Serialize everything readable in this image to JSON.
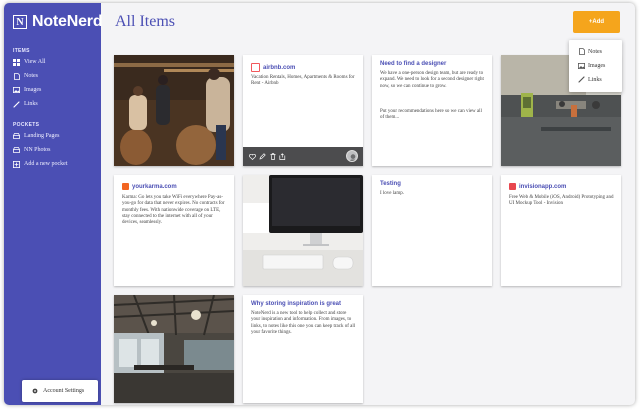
{
  "app": {
    "name": "NoteNerd",
    "logo_letter": "N"
  },
  "sidebar": {
    "items_title": "ITEMS",
    "items": [
      {
        "label": "View All",
        "icon": "grid-icon"
      },
      {
        "label": "Notes",
        "icon": "note-icon"
      },
      {
        "label": "Images",
        "icon": "image-icon"
      },
      {
        "label": "Links",
        "icon": "link-icon"
      }
    ],
    "pockets_title": "POCKETS",
    "pockets": [
      {
        "label": "Landing Pages",
        "icon": "tray-icon"
      },
      {
        "label": "NN Photos",
        "icon": "tray-icon"
      },
      {
        "label": "Add a new pocket",
        "icon": "plus-square-icon"
      }
    ],
    "account": {
      "label": "Account Settings",
      "icon": "gear-icon"
    }
  },
  "header": {
    "title": "All Items",
    "add_label": "+Add"
  },
  "add_menu": {
    "items": [
      {
        "label": "Notes",
        "icon": "note-icon"
      },
      {
        "label": "Images",
        "icon": "image-icon"
      },
      {
        "label": "Links",
        "icon": "link-icon"
      }
    ]
  },
  "cards": {
    "airbnb": {
      "link": "airbnb.com",
      "desc": "Vacation Rentals, Homes, Apartments & Rooms for Rent - Airbnb"
    },
    "designer": {
      "title": "Need to find a designer",
      "desc1": "We have a one-person design team, but are ready to expand. We need to look for a second designer right now, so we can continue to grow.",
      "desc2": "Put your recommendations here so we can view all of them..."
    },
    "karma": {
      "link": "yourkarma.com",
      "desc": "Karma: Go lets you take WiFi everywhere Pay-as-you-go for data that never expires. No contracts for monthly fees. With nationwide coverage on LTE, stay connected to the internet with all of your devices, seamlessly."
    },
    "testing": {
      "title": "Testing",
      "desc": "I love lamp."
    },
    "invision": {
      "link": "invisionapp.com",
      "desc": "Free Web & Mobile (iOS, Android) Prototyping and UI Mockup Tool - Invision"
    },
    "inspiration": {
      "title": "Why storing inspiration is great",
      "desc": "NoteNerd is a new tool to help collect and store your inspiration and information. From images, to links, to notes like this one you can keep track of all your favorite things."
    }
  },
  "colors": {
    "sidebar": "#4b4fb4",
    "accent": "#f5a51c",
    "link": "#4b4fb4",
    "card_footer": "#4c4c4e"
  }
}
